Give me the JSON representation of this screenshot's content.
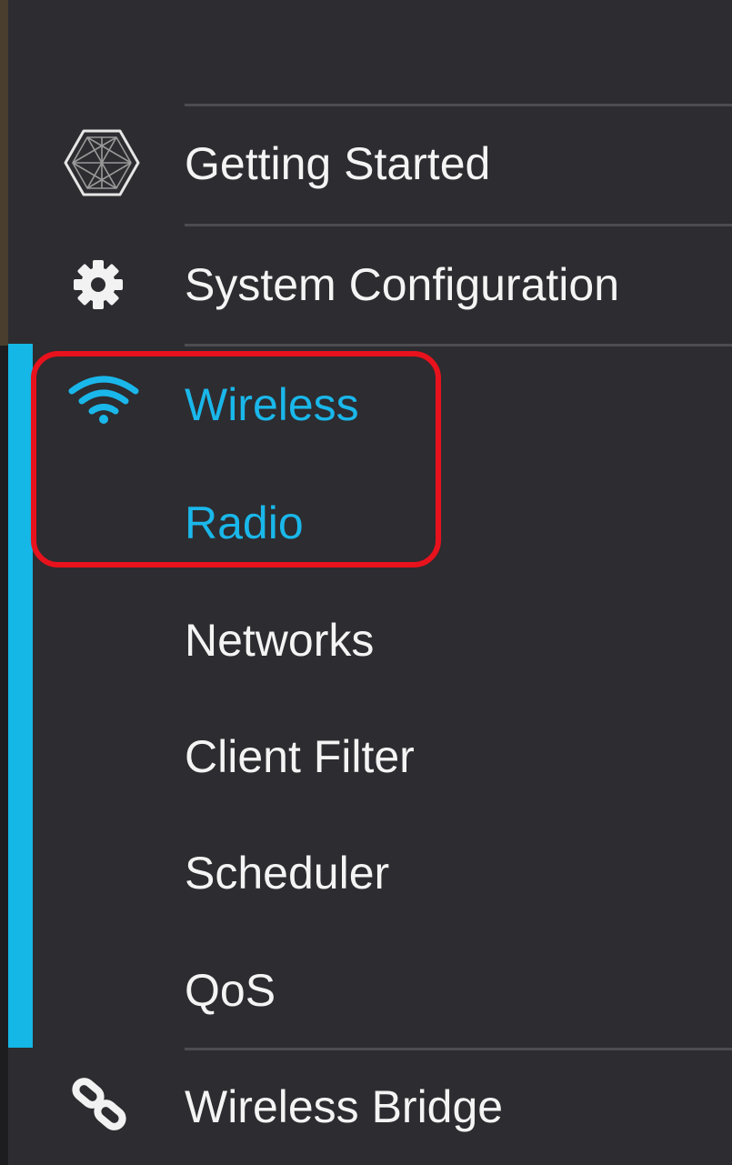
{
  "sidebar": {
    "items": [
      {
        "label": "Getting Started",
        "icon": "cube-icon"
      },
      {
        "label": "System Configuration",
        "icon": "gear-icon"
      },
      {
        "label": "Wireless",
        "icon": "wifi-icon",
        "active": true
      },
      {
        "label": "Radio",
        "active": true
      },
      {
        "label": "Networks"
      },
      {
        "label": "Client Filter"
      },
      {
        "label": "Scheduler"
      },
      {
        "label": "QoS"
      },
      {
        "label": "Wireless Bridge",
        "icon": "link-icon"
      }
    ]
  },
  "colors": {
    "background": "#2d2c30",
    "accent": "#1ab7ea",
    "text": "#f4f4f4",
    "highlight": "#e8121d"
  }
}
